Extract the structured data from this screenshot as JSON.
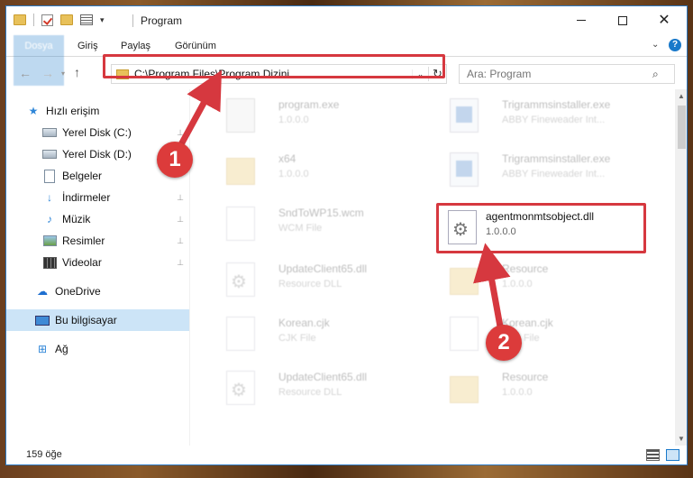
{
  "window": {
    "title": "Program",
    "qa_dropdown": "▾",
    "min_label": "",
    "close_label": "✕"
  },
  "ribbon": {
    "tabs": [
      "Dosya",
      "Giriş",
      "Paylaş",
      "Görünüm"
    ],
    "collapse_glyph": "⌄",
    "help_glyph": "?"
  },
  "nav": {
    "back_glyph": "←",
    "forward_glyph": "→",
    "recent_glyph": "▾",
    "up_glyph": "↑",
    "address": "C:\\Program Files\\Program Dizini",
    "address_dropdown": "⌄",
    "refresh_glyph": "↻",
    "search_placeholder": "Ara: Program",
    "search_glyph": "⌕"
  },
  "sidebar": {
    "items": [
      {
        "label": "Hızlı erişim",
        "icon": "star-icon",
        "pinned": false
      },
      {
        "label": "Yerel Disk (C:)",
        "icon": "drive-icon",
        "pinned": true
      },
      {
        "label": "Yerel Disk (D:)",
        "icon": "drive-icon",
        "pinned": false
      },
      {
        "label": "Belgeler",
        "icon": "documents-icon",
        "pinned": false
      },
      {
        "label": "İndirmeler",
        "icon": "downloads-icon",
        "pinned": true
      },
      {
        "label": "Müzik",
        "icon": "music-icon",
        "pinned": true
      },
      {
        "label": "Resimler",
        "icon": "pictures-icon",
        "pinned": true
      },
      {
        "label": "Videolar",
        "icon": "videos-icon",
        "pinned": true
      },
      {
        "label": "OneDrive",
        "icon": "cloud-icon",
        "pinned": false
      },
      {
        "label": "Bu bilgisayar",
        "icon": "pc-icon",
        "pinned": false,
        "selected": true
      },
      {
        "label": "Ağ",
        "icon": "network-icon",
        "pinned": false
      }
    ],
    "pin_glyph": "📌"
  },
  "files": [
    {
      "name": "program.exe",
      "sub": "1.0.0.0",
      "icon": "exe-icon"
    },
    {
      "name": "Trigrammsinstaller.exe",
      "sub": "ABBY Fineweader Int...",
      "icon": "app-icon"
    },
    {
      "name": "x64",
      "sub": "1.0.0.0",
      "icon": "folder-icon"
    },
    {
      "name": "Trigrammsinstaller.exe",
      "sub": "ABBY Fineweader Int...",
      "icon": "app-icon"
    },
    {
      "name": "SndToWP15.wcm",
      "sub": "WCM File",
      "icon": "file-icon"
    },
    {
      "name": "agentmonmtsobject.dll",
      "sub": "1.0.0.0",
      "icon": "dll-gear-icon",
      "focused": true
    },
    {
      "name": "UpdateClient65.dll",
      "sub": "Resource DLL",
      "icon": "dll-gear-icon"
    },
    {
      "name": "Resource",
      "sub": "1.0.0.0",
      "icon": "folder-icon"
    },
    {
      "name": "Korean.cjk",
      "sub": "CJK File",
      "icon": "file-icon"
    },
    {
      "name": "Korean.cjk",
      "sub": "CJK File",
      "icon": "file-icon"
    },
    {
      "name": "UpdateClient65.dll",
      "sub": "Resource DLL",
      "icon": "dll-gear-icon"
    },
    {
      "name": "Resource",
      "sub": "1.0.0.0",
      "icon": "folder-icon"
    }
  ],
  "status": {
    "item_count": "159 öğe"
  },
  "annotations": {
    "step1": "1",
    "step2": "2",
    "color": "#d6383f"
  }
}
